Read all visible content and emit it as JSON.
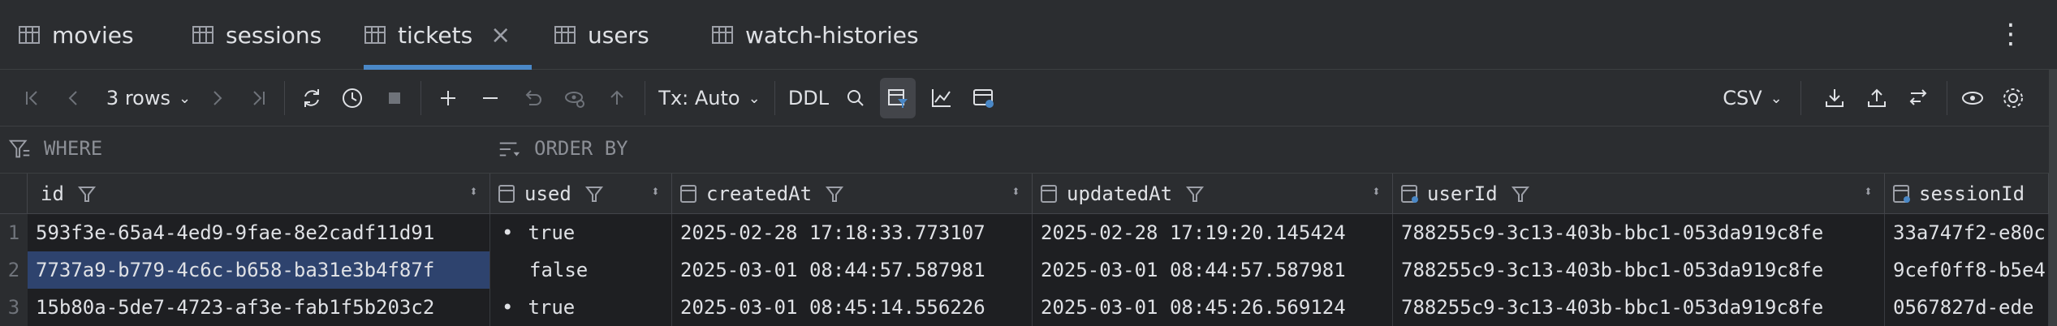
{
  "tabs": [
    {
      "label": "movies",
      "icon": "table-icon"
    },
    {
      "label": "sessions",
      "icon": "table-icon"
    },
    {
      "label": "tickets",
      "icon": "table-icon",
      "active": true
    },
    {
      "label": "users",
      "icon": "table-icon"
    },
    {
      "label": "watch-histories",
      "icon": "table-icon"
    }
  ],
  "toolbar": {
    "rows_label": "3 rows",
    "tx_label": "Tx: Auto",
    "ddl_label": "DDL",
    "export_label": "CSV"
  },
  "filter": {
    "where_label": "WHERE",
    "orderby_label": "ORDER BY"
  },
  "columns": [
    {
      "label": "id"
    },
    {
      "label": "used"
    },
    {
      "label": "createdAt"
    },
    {
      "label": "updatedAt"
    },
    {
      "label": "userId"
    },
    {
      "label": "sessionId"
    }
  ],
  "rows": [
    {
      "num": "1",
      "id": "593f3e-65a4-4ed9-9fae-8e2cadf11d91",
      "used_dot": "•",
      "used": "true",
      "createdAt": "2025-02-28 17:18:33.773107",
      "updatedAt": "2025-02-28 17:19:20.145424",
      "userId": "788255c9-3c13-403b-bbc1-053da919c8fe",
      "sessionId": "33a747f2-e80c"
    },
    {
      "num": "2",
      "id": "7737a9-b779-4c6c-b658-ba31e3b4f87f",
      "used_dot": "",
      "used": "false",
      "createdAt": "2025-03-01 08:44:57.587981",
      "updatedAt": "2025-03-01 08:44:57.587981",
      "userId": "788255c9-3c13-403b-bbc1-053da919c8fe",
      "sessionId": "9cef0ff8-b5e4"
    },
    {
      "num": "3",
      "id": "15b80a-5de7-4723-af3e-fab1f5b203c2",
      "used_dot": "•",
      "used": "true",
      "createdAt": "2025-03-01 08:45:14.556226",
      "updatedAt": "2025-03-01 08:45:26.569124",
      "userId": "788255c9-3c13-403b-bbc1-053da919c8fe",
      "sessionId": "0567827d-ede"
    }
  ],
  "colors": {
    "accent": "#4a88c7",
    "selection": "#2e436e",
    "background": "#1e1f22",
    "panel": "#2b2d30"
  }
}
